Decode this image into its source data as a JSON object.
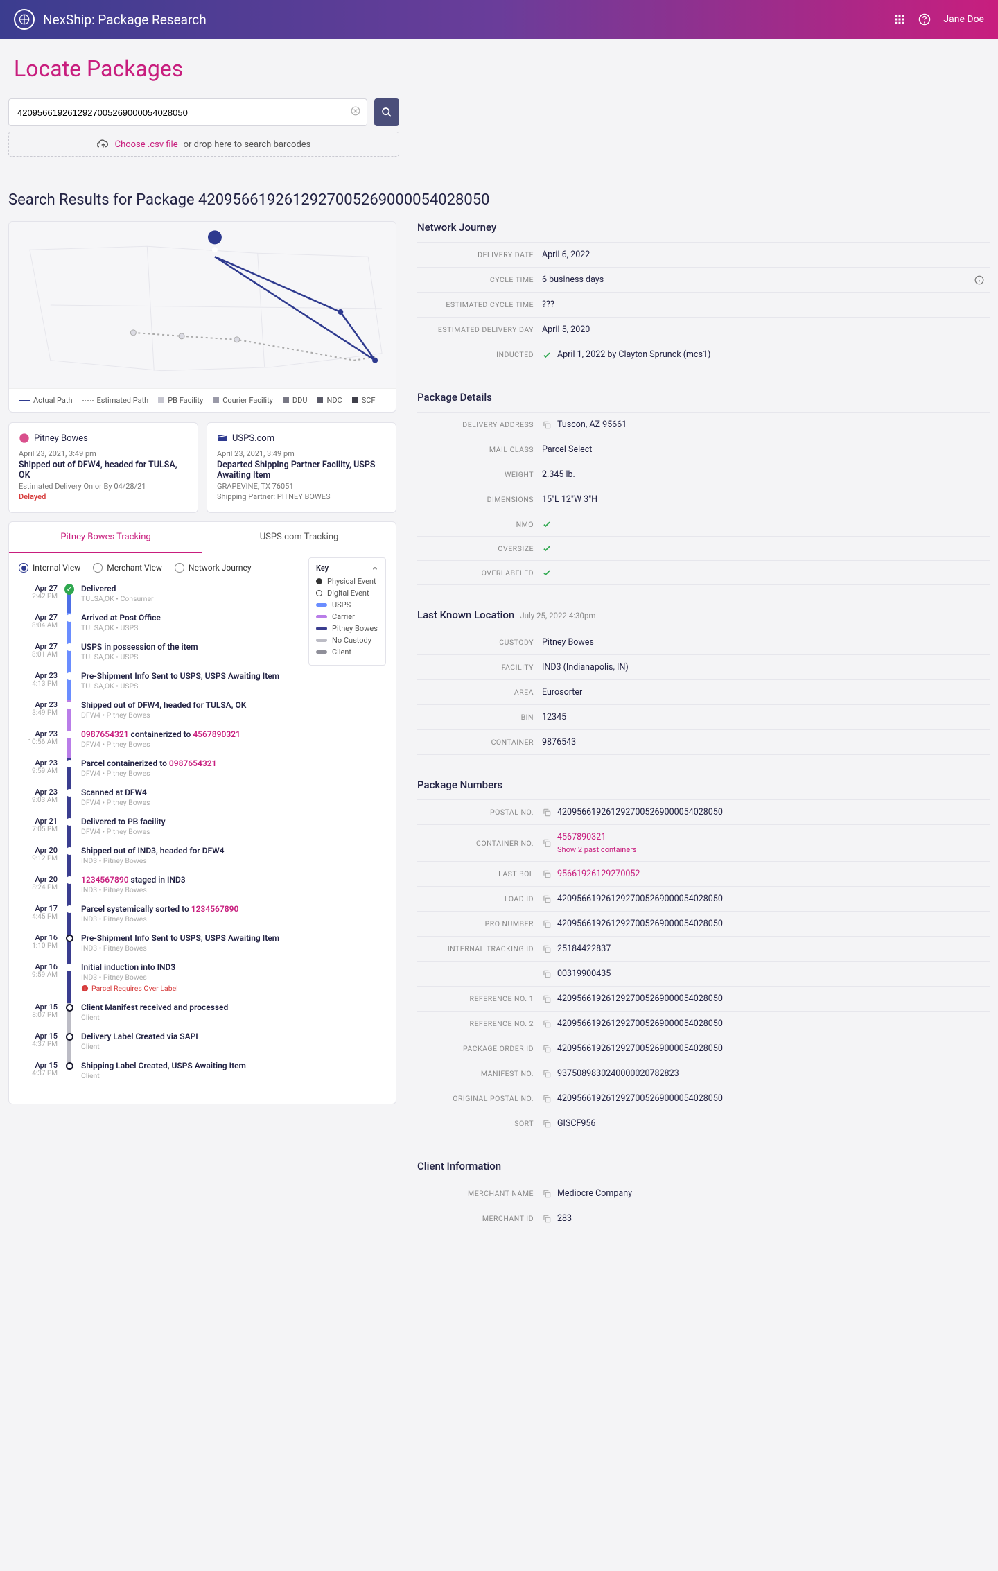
{
  "header": {
    "title": "NexShip: Package Research",
    "user": "Jane Doe"
  },
  "page_title": "Locate Packages",
  "search": {
    "value": "4209566192612927005269000054028050",
    "dropzone_link": "Choose .csv file",
    "dropzone_text": "or drop here to search barcodes"
  },
  "results_heading_prefix": "Search Results for Package ",
  "results_heading_id": "4209566192612927005269000054028050",
  "map_legend": {
    "actual": "Actual Path",
    "estimated": "Estimated Path",
    "pb": "PB Facility",
    "courier": "Courier Facility",
    "ddu": "DDU",
    "ndc": "NDC",
    "scf": "SCF"
  },
  "carrier_cards": {
    "pb": {
      "name": "Pitney Bowes",
      "time": "April 23, 2021, 3:49 pm",
      "title": "Shipped out of DFW4, headed for TULSA, OK",
      "sub": "Estimated Delivery On or By 04/28/21",
      "status": "Delayed"
    },
    "usps": {
      "name": "USPS.com",
      "time": "April 23, 2021, 3:49 pm",
      "title": "Departed Shipping Partner Facility, USPS Awaiting Item",
      "sub1": "GRAPEVINE, TX 76051",
      "sub2": "Shipping Partner:  PITNEY BOWES"
    }
  },
  "tabs": {
    "pb": "Pitney Bowes Tracking",
    "usps": "USPS.com Tracking"
  },
  "views": {
    "internal": "Internal View",
    "merchant": "Merchant View",
    "network": "Network Journey"
  },
  "key": {
    "title": "Key",
    "physical": "Physical Event",
    "digital": "Digital Event",
    "usps": "USPS",
    "carrier": "Carrier",
    "pb": "Pitney Bowes",
    "none": "No Custody",
    "client": "Client"
  },
  "timeline": [
    {
      "d": "Apr 27",
      "t": "2:42 PM",
      "title": "Delivered",
      "meta": "TULSA,OK  •  Consumer",
      "bar": "bar-usps-full",
      "check": true
    },
    {
      "d": "Apr 27",
      "t": "8:04 AM",
      "title": "Arrived at Post Office",
      "meta": "TULSA,OK  •  USPS",
      "bar": "bar-usps"
    },
    {
      "d": "Apr 27",
      "t": "8:01 AM",
      "title": "USPS in possession of the item",
      "meta": "TULSA,OK  •  USPS",
      "bar": "bar-usps"
    },
    {
      "d": "Apr 23",
      "t": "4:13 PM",
      "title": "Pre-Shipment Info Sent to USPS, USPS Awaiting Item",
      "meta": "TULSA,OK  •  USPS",
      "bar": "bar-usps"
    },
    {
      "d": "Apr 23",
      "t": "3:49 PM",
      "title": "Shipped out of DFW4, headed for TULSA, OK",
      "meta": "DFW4  •  Pitney Bowes",
      "bar": "bar-carrier"
    },
    {
      "d": "Apr 23",
      "t": "10:56 AM",
      "title_html": "<span class='tl-pink'>0987654321</span> containerized to <span class='tl-pink'>4567890321</span>",
      "meta": "DFW4  •  Pitney Bowes",
      "bar": "bar-carrier"
    },
    {
      "d": "Apr 23",
      "t": "9:59 AM",
      "title_html": "Parcel containerized to <span class='tl-pink'>0987654321</span>",
      "meta": "DFW4  •  Pitney Bowes",
      "bar": "bar-pb"
    },
    {
      "d": "Apr 23",
      "t": "9:03 AM",
      "title": "Scanned at DFW4",
      "meta": "DFW4  •  Pitney Bowes",
      "bar": "bar-pb"
    },
    {
      "d": "Apr 21",
      "t": "7:05 PM",
      "title": "Delivered to PB facility",
      "meta": "DFW4  •  Pitney Bowes",
      "bar": "bar-pb"
    },
    {
      "d": "Apr 20",
      "t": "9:12 PM",
      "title": "Shipped out of IND3, headed for DFW4",
      "meta": "IND3  •  Pitney Bowes",
      "bar": "bar-pb"
    },
    {
      "d": "Apr 20",
      "t": "8:24 PM",
      "title_html": "<span class='tl-pink'>1234567890</span> staged in IND3",
      "meta": "IND3  •  Pitney Bowes",
      "bar": "bar-pb"
    },
    {
      "d": "Apr 17",
      "t": "4:45 PM",
      "title_html": "Parcel systemically sorted to <span class='tl-pink'>1234567890</span>",
      "meta": "IND3  •  Pitney Bowes",
      "bar": "bar-pb"
    },
    {
      "d": "Apr 16",
      "t": "1:10 PM",
      "title": "Pre-Shipment Info Sent to USPS, USPS Awaiting Item",
      "meta": "IND3  •  Pitney Bowes",
      "bar": "bar-pb",
      "hollow": true
    },
    {
      "d": "Apr 16",
      "t": "9:59 AM",
      "title": "Initial induction into IND3",
      "meta": "IND3  •  Pitney Bowes",
      "bar": "bar-pb",
      "flag": "Parcel Requires Over Label"
    },
    {
      "d": "Apr 15",
      "t": "8:07 PM",
      "title": "Client Manifest received and processed",
      "meta": "Client",
      "bar": "bar-none",
      "hollow": true
    },
    {
      "d": "Apr 15",
      "t": "4:37 PM",
      "title": "Delivery Label Created via SAPI",
      "meta": "Client",
      "bar": "bar-none",
      "hollow": true
    },
    {
      "d": "Apr 15",
      "t": "4:37 PM",
      "title": "Shipping Label Created, USPS Awaiting Item",
      "meta": "Client",
      "bar": "bar-none",
      "hollow": true
    }
  ],
  "network_journey": {
    "title": "Network Journey",
    "rows": [
      {
        "k": "Delivery Date",
        "v": "April 6, 2022"
      },
      {
        "k": "Cycle Time",
        "v": "6 business days",
        "info": true
      },
      {
        "k": "Estimated Cycle Time",
        "v": "???"
      },
      {
        "k": "Estimated Delivery Day",
        "v": "April 5, 2020"
      },
      {
        "k": "Inducted",
        "v": "April 1, 2022 by Clayton Sprunck (mcs1)",
        "check": true
      }
    ]
  },
  "package_details": {
    "title": "Package Details",
    "rows": [
      {
        "k": "Delivery Address",
        "v": "Tuscon, AZ 95661",
        "copy": true
      },
      {
        "k": "Mail Class",
        "v": "Parcel Select"
      },
      {
        "k": "Weight",
        "v": "2.345 lb."
      },
      {
        "k": "Dimensions",
        "v": "15\"L 12\"W 3\"H"
      },
      {
        "k": "NMO",
        "v": "",
        "check": true
      },
      {
        "k": "Oversize",
        "v": "",
        "check": true
      },
      {
        "k": "Overlabeled",
        "v": "",
        "check": true
      }
    ]
  },
  "last_known": {
    "title": "Last Known Location",
    "subtitle": "July 25, 2022 4:30pm",
    "rows": [
      {
        "k": "Custody",
        "v": "Pitney Bowes"
      },
      {
        "k": "Facility",
        "v": "IND3 (Indianapolis, IN)"
      },
      {
        "k": "Area",
        "v": "Eurosorter"
      },
      {
        "k": "Bin",
        "v": "12345"
      },
      {
        "k": "Container",
        "v": "9876543"
      }
    ]
  },
  "package_numbers": {
    "title": "Package Numbers",
    "rows": [
      {
        "k": "Postal No.",
        "v": "4209566192612927005269000054028050",
        "copy": true
      },
      {
        "k": "Container No.",
        "v": "4567890321",
        "copy": true,
        "pink": true,
        "sub": "Show 2 past containers"
      },
      {
        "k": "Last BOL",
        "v": "95661926129270052",
        "copy": true,
        "pink": true
      },
      {
        "k": "Load ID",
        "v": "4209566192612927005269000054028050",
        "copy": true
      },
      {
        "k": "Pro Number",
        "v": "4209566192612927005269000054028050",
        "copy": true
      },
      {
        "k": "Internal Tracking ID",
        "v": "25184422837",
        "copy": true
      },
      {
        "k": "",
        "v": "00319900435",
        "copy": true
      },
      {
        "k": "Reference No. 1",
        "v": "4209566192612927005269000054028050",
        "copy": true
      },
      {
        "k": "Reference No. 2",
        "v": "4209566192612927005269000054028050",
        "copy": true
      },
      {
        "k": "Package Order ID",
        "v": "4209566192612927005269000054028050",
        "copy": true
      },
      {
        "k": "Manifest No.",
        "v": "9375089830240000020782823",
        "copy": true
      },
      {
        "k": "Original Postal No.",
        "v": "4209566192612927005269000054028050",
        "copy": true
      },
      {
        "k": "Sort",
        "v": "GISCF956",
        "copy": true
      }
    ]
  },
  "client_info": {
    "title": "Client Information",
    "rows": [
      {
        "k": "Merchant Name",
        "v": "Mediocre Company",
        "copy": true
      },
      {
        "k": "Merchant ID",
        "v": "283",
        "copy": true
      }
    ]
  }
}
